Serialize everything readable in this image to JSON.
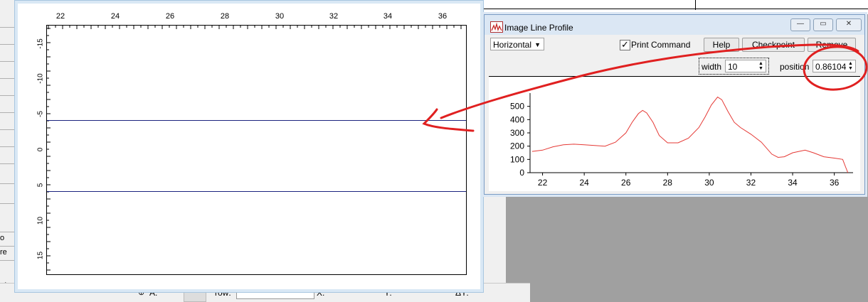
{
  "background": {
    "left_strip": {
      "labels": [
        "o",
        "re",
        "A"
      ]
    },
    "bottom_bar": {
      "row_label": "row:",
      "x_label": "X:",
      "y_label": "Y:",
      "dy_label": "ΔY:",
      "a_label": "A:"
    }
  },
  "image_window": {
    "top_ticks": [
      "22",
      "24",
      "26",
      "28",
      "30",
      "32",
      "34",
      "36"
    ],
    "left_ticks": [
      "-15",
      "-10",
      "-5",
      "0",
      "5",
      "10",
      "15"
    ],
    "line_color": "#1a237e"
  },
  "profile_window": {
    "title": "Image Line Profile",
    "window_buttons": {
      "minimize": "—",
      "maximize": "▭",
      "close": "✕"
    },
    "orientation": {
      "selected": "Horizontal"
    },
    "print_command": {
      "label": "Print Command",
      "checked": true,
      "check_glyph": "✓"
    },
    "buttons": {
      "help": "Help",
      "checkpoint": "Checkpoint",
      "remove": "Remove"
    },
    "width": {
      "label": "width",
      "value": "10"
    },
    "position": {
      "label": "position",
      "value": "0.86104"
    }
  },
  "chart_data": {
    "type": "line",
    "x_ticks": [
      22,
      24,
      26,
      28,
      30,
      32,
      34,
      36
    ],
    "y_ticks": [
      0,
      100,
      200,
      300,
      400,
      500
    ],
    "xlim": [
      21.4,
      36.9
    ],
    "ylim": [
      0,
      600
    ],
    "color": "#e53935",
    "series": [
      {
        "x": [
          21.5,
          22.0,
          22.5,
          23.0,
          23.5,
          24.0,
          24.5,
          25.0,
          25.5,
          26.0,
          26.3,
          26.6,
          26.8,
          27.0,
          27.3,
          27.6,
          28.0,
          28.5,
          29.0,
          29.5,
          29.8,
          30.1,
          30.4,
          30.6,
          30.9,
          31.2,
          31.5,
          32.0,
          32.5,
          33.0,
          33.3,
          33.6,
          34.0,
          34.3,
          34.6,
          35.0,
          35.5,
          36.0,
          36.4,
          36.55,
          36.65
        ],
        "y": [
          160,
          170,
          195,
          210,
          215,
          210,
          205,
          200,
          230,
          300,
          380,
          445,
          470,
          450,
          380,
          280,
          225,
          225,
          260,
          340,
          420,
          510,
          570,
          550,
          460,
          380,
          340,
          290,
          230,
          140,
          115,
          120,
          150,
          160,
          170,
          150,
          120,
          110,
          100,
          40,
          0
        ]
      }
    ]
  }
}
